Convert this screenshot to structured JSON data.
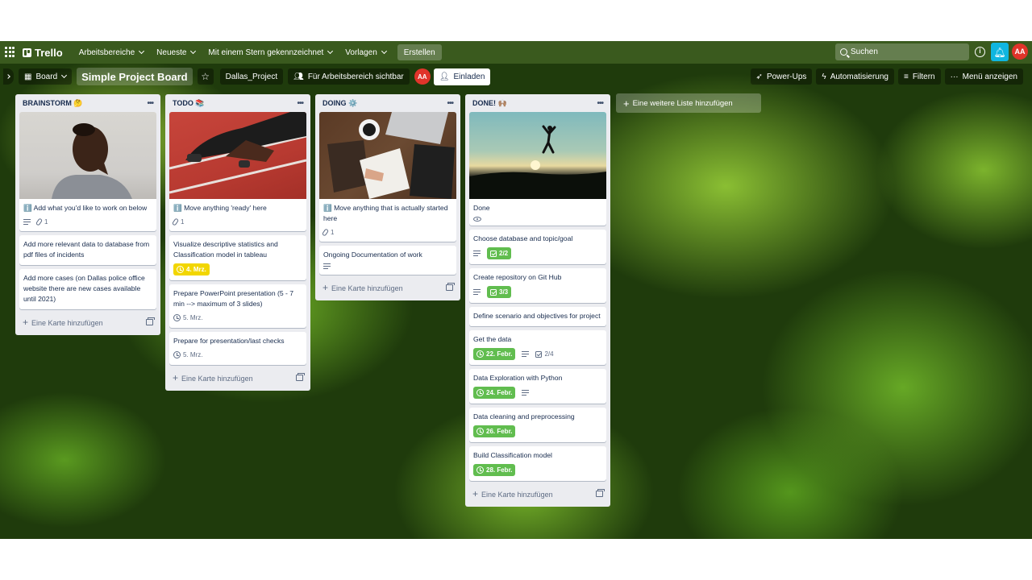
{
  "header": {
    "logo": "Trello",
    "menu": [
      {
        "label": "Arbeitsbereiche"
      },
      {
        "label": "Neueste"
      },
      {
        "label": "Mit einem Stern gekennzeichnet"
      },
      {
        "label": "Vorlagen"
      }
    ],
    "create_label": "Erstellen",
    "search_placeholder": "Suchen",
    "avatar": "AA",
    "accent_color": "#10b6e0"
  },
  "board": {
    "view_label": "Board",
    "title": "Simple Project Board",
    "workspace_label": "Dallas_Project",
    "visibility_label": "Für Arbeitsbereich sichtbar",
    "member_initials": "AA",
    "invite_label": "Einladen",
    "powerups_label": "Power-Ups",
    "automation_label": "Automatisierung",
    "filter_label": "Filtern",
    "menu_label": "Menü anzeigen",
    "add_list_label": "Eine weitere Liste hinzufügen",
    "add_card_label": "Eine Karte hinzufügen"
  },
  "lists": [
    {
      "title": "BRAINSTORM 🤔",
      "cards": [
        {
          "title": "ℹ️ Add what you'd like to work on below",
          "desc": true,
          "attachments": "1"
        },
        {
          "title": "Add more relevant data to database from pdf files of incidents"
        },
        {
          "title": "Add more cases (on Dallas police office website there are new cases available until 2021)"
        }
      ]
    },
    {
      "title": "TODO 📚",
      "cards": [
        {
          "title": "ℹ️ Move anything 'ready' here",
          "attachments": "1"
        },
        {
          "title": "Visualize descriptive statistics and Classification model in tableau",
          "due": "4. Mrz.",
          "due_color": "#f2d600"
        },
        {
          "title": "Prepare PowerPoint presentation (5 - 7 min --> maximum of 3 slides)",
          "due": "5. Mrz."
        },
        {
          "title": "Prepare for presentation/last checks",
          "due": "5. Mrz."
        }
      ]
    },
    {
      "title": "DOING ⚙️",
      "cards": [
        {
          "title": "ℹ️ Move anything that is actually started here",
          "attachments": "1"
        },
        {
          "title": "Ongoing Documentation of work",
          "desc": true
        }
      ]
    },
    {
      "title": "DONE! 🙌🏽",
      "cards": [
        {
          "title": "Done",
          "watch": true
        },
        {
          "title": "Choose database and topic/goal",
          "desc": true,
          "checklist": "2/2"
        },
        {
          "title": "Create repository on Git Hub",
          "desc": true,
          "checklist": "3/3"
        },
        {
          "title": "Define scenario and objectives for project"
        },
        {
          "title": "Get the data",
          "due": "22. Febr.",
          "desc": true,
          "checklist": "2/4"
        },
        {
          "title": "Data Exploration with Python",
          "due": "24. Febr.",
          "desc": true
        },
        {
          "title": "Data cleaning and preprocessing",
          "due": "26. Febr."
        },
        {
          "title": "Build Classification model",
          "due": "28. Febr."
        }
      ]
    }
  ]
}
